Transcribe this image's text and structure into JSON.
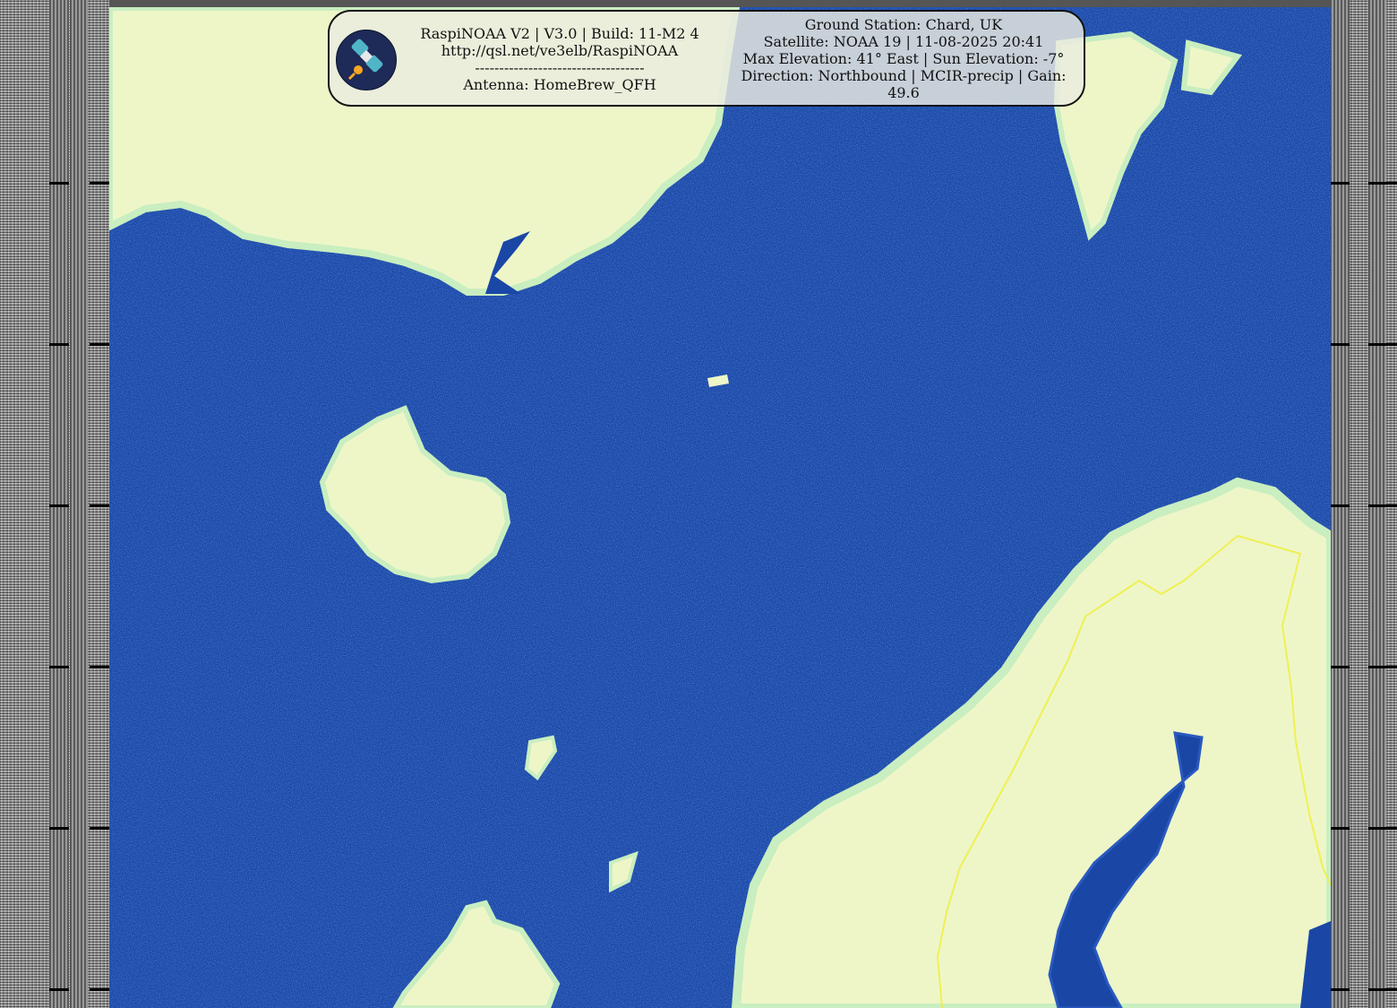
{
  "info_panel": {
    "left_lines": [
      "RaspiNOAA V2 | V3.0 | Build: 11-M2 4",
      "http://qsl.net/ve3elb/RaspiNOAA",
      "-----------------------------------",
      "Antenna: HomeBrew_QFH"
    ],
    "right_lines": [
      "Ground Station: Chard, UK",
      "Satellite: NOAA 19 | 11-08-2025 20:41",
      "Max Elevation: 41° East | Sun Elevation: -7°",
      "Direction: Northbound | MCIR-precip | Gain: 49.6"
    ],
    "logo_icon": "satellite-icon"
  },
  "colors": {
    "ocean": "#1a47a6",
    "land": "#eef6c8",
    "land_edge": "#c9eec0",
    "border": "#f0ef40",
    "panel_bg": "#ebebe1"
  }
}
